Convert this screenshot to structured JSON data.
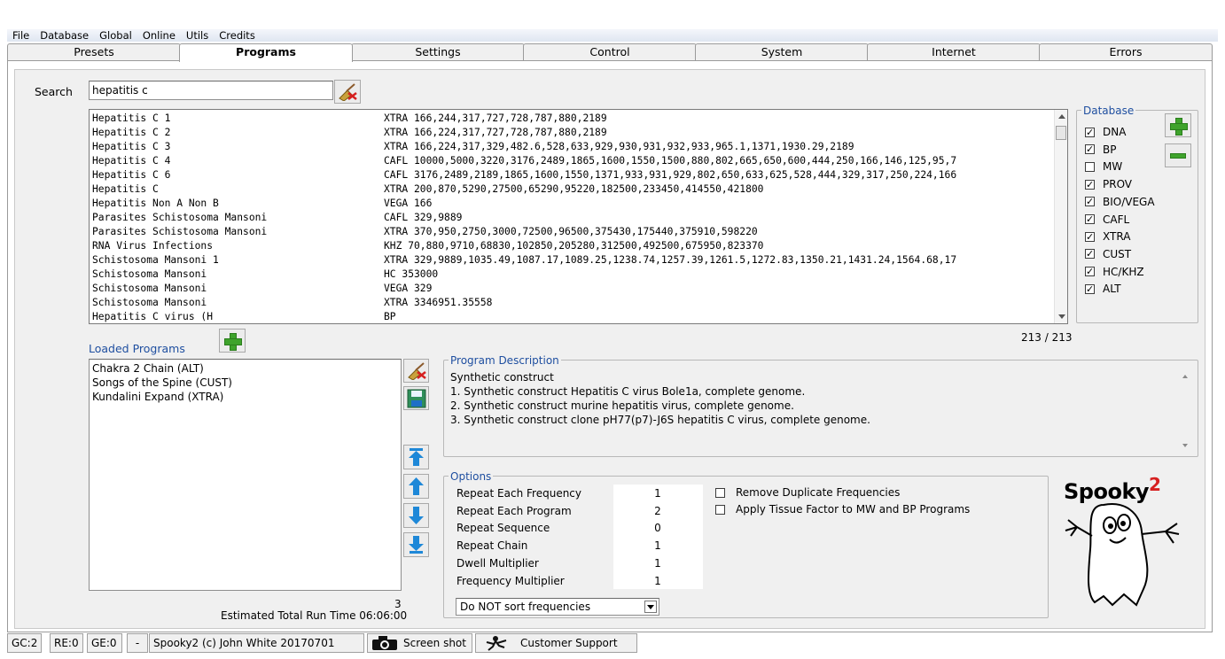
{
  "menu": [
    "File",
    "Database",
    "Global",
    "Online",
    "Utils",
    "Credits"
  ],
  "tabs": [
    "Presets",
    "Programs",
    "Settings",
    "Control",
    "System",
    "Internet",
    "Errors"
  ],
  "active_tab": "Programs",
  "search": {
    "label": "Search",
    "value": "hepatitis c"
  },
  "program_list": [
    {
      "name": "Hepatitis C 1",
      "freqs": "XTRA 166,244,317,727,728,787,880,2189"
    },
    {
      "name": "Hepatitis C 2",
      "freqs": "XTRA 166,224,317,727,728,787,880,2189"
    },
    {
      "name": "Hepatitis C 3",
      "freqs": "XTRA 166,224,317,329,482.6,528,633,929,930,931,932,933,965.1,1371,1930.29,2189"
    },
    {
      "name": "Hepatitis C 4",
      "freqs": "CAFL 10000,5000,3220,3176,2489,1865,1600,1550,1500,880,802,665,650,600,444,250,166,146,125,95,7"
    },
    {
      "name": "Hepatitis C 6",
      "freqs": "CAFL 3176,2489,2189,1865,1600,1550,1371,933,931,929,802,650,633,625,528,444,329,317,250,224,166"
    },
    {
      "name": "Hepatitis C",
      "freqs": "XTRA 200,870,5290,27500,65290,95220,182500,233450,414550,421800"
    },
    {
      "name": "Hepatitis Non A Non B",
      "freqs": "VEGA 166"
    },
    {
      "name": "Parasites Schistosoma Mansoni",
      "freqs": "CAFL 329,9889"
    },
    {
      "name": "Parasites Schistosoma Mansoni",
      "freqs": "XTRA 370,950,2750,3000,72500,96500,375430,175440,375910,598220"
    },
    {
      "name": "RNA Virus Infections",
      "freqs": "KHZ  70,880,9710,68830,102850,205280,312500,492500,675950,823370"
    },
    {
      "name": "Schistosoma Mansoni 1",
      "freqs": "XTRA 329,9889,1035.49,1087.17,1089.25,1238.74,1257.39,1261.5,1272.83,1350.21,1431.24,1564.68,17"
    },
    {
      "name": "Schistosoma Mansoni",
      "freqs": "HC   353000"
    },
    {
      "name": "Schistosoma Mansoni",
      "freqs": "VEGA 329"
    },
    {
      "name": "Schistosoma Mansoni",
      "freqs": "XTRA 3346951.35558"
    },
    {
      "name": "Hepatitis C virus (H",
      "freqs": "BP"
    }
  ],
  "database": {
    "label": "Database",
    "items": [
      {
        "name": "DNA",
        "checked": true
      },
      {
        "name": "BP",
        "checked": true
      },
      {
        "name": "MW",
        "checked": false
      },
      {
        "name": "PROV",
        "checked": true
      },
      {
        "name": "BIO/VEGA",
        "checked": true
      },
      {
        "name": "CAFL",
        "checked": true
      },
      {
        "name": "XTRA",
        "checked": true
      },
      {
        "name": "CUST",
        "checked": true
      },
      {
        "name": "HC/KHZ",
        "checked": true
      },
      {
        "name": "ALT",
        "checked": true
      }
    ]
  },
  "result_count": "213 / 213",
  "loaded": {
    "label": "Loaded Programs",
    "items": [
      "Chakra 2 Chain (ALT)",
      "Songs of the Spine (CUST)",
      "Kundalini Expand (XTRA)"
    ],
    "count": "3",
    "runtime": "Estimated Total Run Time 06:06:00"
  },
  "description": {
    "label": "Program Description",
    "lines": [
      "Synthetic construct",
      "1. Synthetic construct Hepatitis C virus Bole1a, complete genome.",
      "2. Synthetic construct murine hepatitis virus, complete genome.",
      "3. Synthetic construct clone pH77(p7)-J6S hepatitis C virus, complete genome."
    ]
  },
  "options": {
    "label": "Options",
    "rows": [
      {
        "label": "Repeat Each Frequency",
        "value": "1"
      },
      {
        "label": "Repeat Each Program",
        "value": "2"
      },
      {
        "label": "Repeat Sequence",
        "value": "0"
      },
      {
        "label": "Repeat Chain",
        "value": "1"
      },
      {
        "label": "Dwell Multiplier",
        "value": "1"
      },
      {
        "label": "Frequency Multiplier",
        "value": "1"
      }
    ],
    "checkboxes": [
      {
        "label": "Remove Duplicate Frequencies",
        "checked": false
      },
      {
        "label": "Apply Tissue Factor to MW and BP Programs",
        "checked": false
      }
    ],
    "sort_select": "Do NOT sort frequencies"
  },
  "logo_text": "Spooky",
  "logo_sup": "2",
  "statusbar": {
    "gc": "GC:2",
    "re": "RE:0",
    "ge": "GE:0",
    "dash": "-",
    "copyright": "Spooky2 (c) John White 20170701",
    "screenshot": "Screen shot",
    "support": "Customer Support"
  },
  "colors": {
    "accent_blue": "#1f4fa0",
    "plus_green": "#3fa32c",
    "arrow_blue": "#1e88d8"
  }
}
